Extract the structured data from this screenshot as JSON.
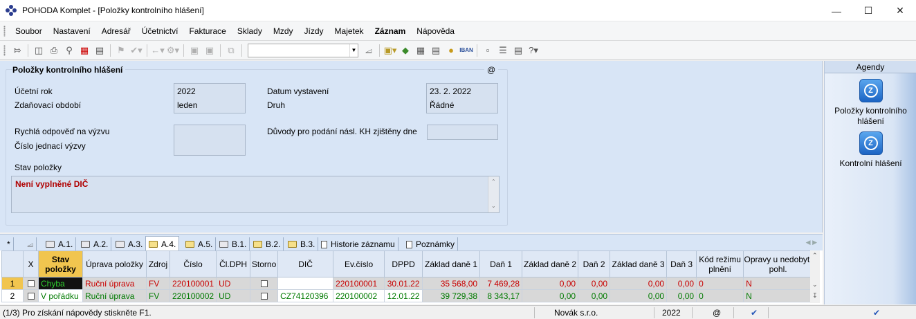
{
  "window": {
    "title": "POHODA Komplet - [Položky kontrolního hlášení]"
  },
  "menu": [
    "Soubor",
    "Nastavení",
    "Adresář",
    "Účetnictví",
    "Fakturace",
    "Sklady",
    "Mzdy",
    "Jízdy",
    "Majetek",
    "Záznam",
    "Nápověda"
  ],
  "form": {
    "section_title": "Položky kontrolního hlášení",
    "at_symbol": "@",
    "ucetni_rok_label": "Účetní rok",
    "ucetni_rok_value": "2022",
    "zdanovaci_obdobi_label": "Zdaňovací období",
    "zdanovaci_obdobi_value": "leden",
    "datum_vystaveni_label": "Datum vystavení",
    "datum_vystaveni_value": "23. 2. 2022",
    "druh_label": "Druh",
    "druh_value": "Řádné",
    "rychla_odpoved_label": "Rychlá odpověď na výzvu",
    "cislo_jednaci_label": "Číslo jednací výzvy",
    "duvody_label": "Důvody pro podání násl. KH zjištěny dne",
    "stav_polozky_label": "Stav položky",
    "stav_polozky_value": "Není vyplněné DIČ"
  },
  "agendy": {
    "header": "Agendy",
    "items": [
      {
        "label": "Položky kontrolního hlášení"
      },
      {
        "label": "Kontrolní hlášení"
      }
    ]
  },
  "tabs": [
    {
      "label": "*"
    },
    {
      "label": ""
    },
    {
      "label": "A.1."
    },
    {
      "label": "A.2."
    },
    {
      "label": "A.3."
    },
    {
      "label": "A.4."
    },
    {
      "label": "A.5."
    },
    {
      "label": "B.1."
    },
    {
      "label": "B.2."
    },
    {
      "label": "B.3."
    },
    {
      "label": "Historie záznamu"
    },
    {
      "label": "Poznámky"
    }
  ],
  "grid": {
    "columns": [
      "X",
      "Stav položky",
      "Úprava položky",
      "Zdroj",
      "Číslo",
      "Čl.DPH",
      "Storno",
      "DIČ",
      "Ev.číslo",
      "DPPD",
      "Základ daně 1",
      "Daň 1",
      "Základ daně 2",
      "Daň 2",
      "Základ daně 3",
      "Daň 3",
      "Kód režimu plnění",
      "Opravy u nedobyt. pohl."
    ],
    "rows": [
      {
        "n": "1",
        "stav": "Chyba",
        "uprava": "Ruční úprava",
        "zdroj": "FV",
        "cislo": "220100001",
        "cldph": "UD",
        "dic": "",
        "evcislo": "220100001",
        "dppd": "30.01.22",
        "zaklad1": "35 568,00",
        "dan1": "7 469,28",
        "zaklad2": "0,00",
        "dan2": "0,00",
        "zaklad3": "0,00",
        "dan3": "0,00",
        "kod": "0",
        "opravy": "N"
      },
      {
        "n": "2",
        "stav": "V pořádku",
        "uprava": "Ruční úprava",
        "zdroj": "FV",
        "cislo": "220100002",
        "cldph": "UD",
        "dic": "CZ74120396",
        "evcislo": "220100002",
        "dppd": "12.01.22",
        "zaklad1": "39 729,38",
        "dan1": "8 343,17",
        "zaklad2": "0,00",
        "dan2": "0,00",
        "zaklad3": "0,00",
        "dan3": "0,00",
        "kod": "0",
        "opravy": "N"
      }
    ]
  },
  "statusbar": {
    "help": "(1/3) Pro získání nápovědy stiskněte F1.",
    "company": "Novák s.r.o.",
    "year": "2022",
    "at": "@"
  }
}
